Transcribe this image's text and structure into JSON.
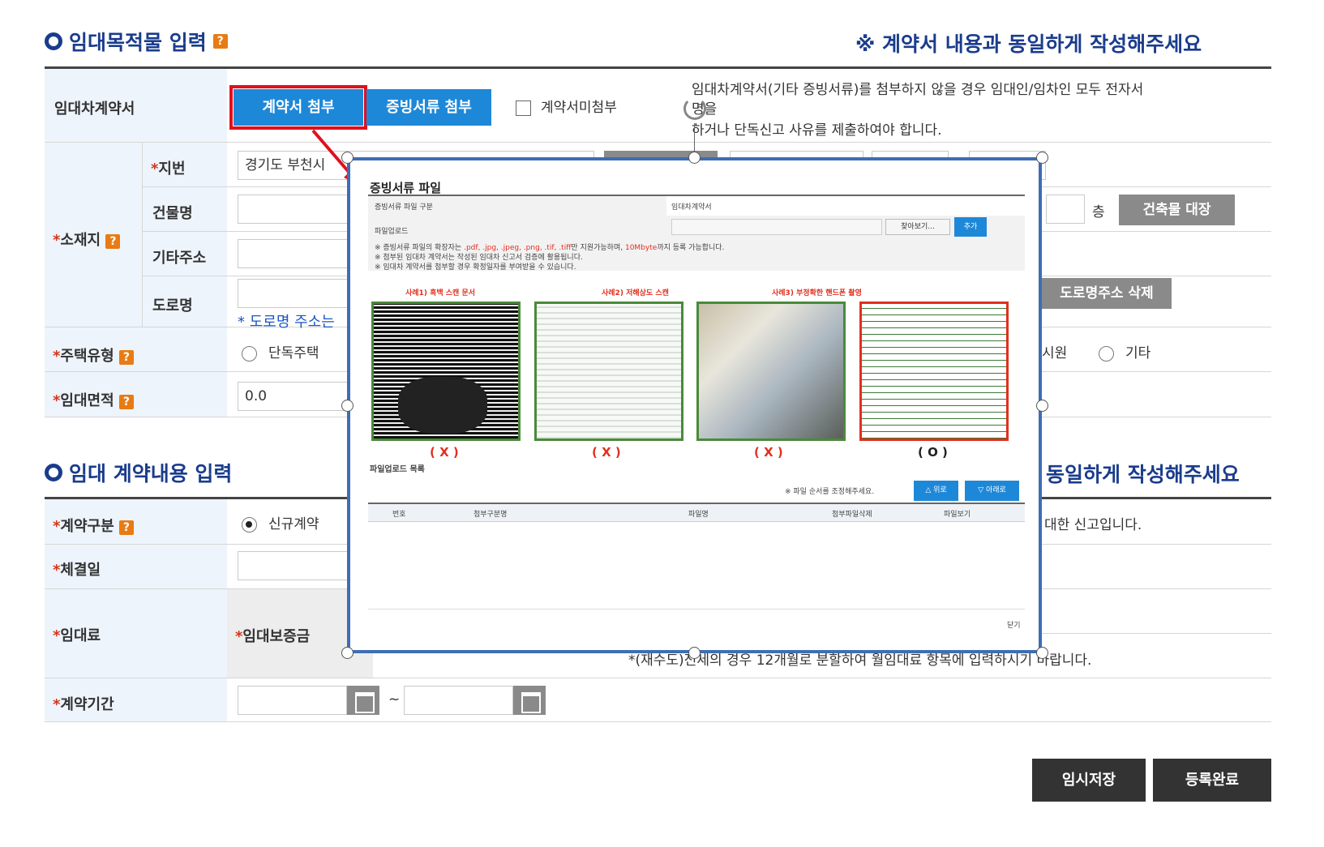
{
  "section1": {
    "title": "임대목적물 입력",
    "notice": "※ 계약서 내용과 동일하게 작성해주세요"
  },
  "contract_row": {
    "label": "임대차계약서",
    "attach_contract_btn": "계약서 첨부",
    "attach_evidence_btn": "증빙서류 첨부",
    "no_attach_label": "계약서미첨부",
    "info_line1": "임대차계약서(기타 증빙서류)를 첨부하지 않을 경우 임대인/임차인 모두 전자서",
    "info_line2": "명을",
    "info_line3": "하거나 단독신고 사유를 제출하여야 합니다."
  },
  "location": {
    "label": "소재지",
    "jibun_label": "지번",
    "jibun_value": "경기도 부천시",
    "building_label": "건물명",
    "floor_unit": "층",
    "building_register_btn": "건축물 대장",
    "other_addr_label": "기타주소",
    "road_label": "도로명",
    "road_hint": "* 도로명 주소는",
    "road_delete_btn": "도로명주소 삭제"
  },
  "housing_type": {
    "label": "주택유형",
    "option_single": "단독주택",
    "option_partial": "시원",
    "option_other": "기타"
  },
  "area": {
    "label": "임대면적",
    "value": "0.0"
  },
  "section2": {
    "title": "임대 계약내용 입력",
    "notice_tail": "동일하게 작성해주세요"
  },
  "contract_type": {
    "label": "계약구분",
    "option_new": "신규계약",
    "note_tail": "대한 신고입니다."
  },
  "signed_date": {
    "label": "체결일"
  },
  "rent": {
    "label": "임대료",
    "deposit_label": "임대보증금",
    "note": "*(재수도)전세의 경우 12개월로 분할하여 월임대료 항목에 입력하시기 바랍니다."
  },
  "period": {
    "label": "계약기간",
    "separator": "~"
  },
  "footer": {
    "temp_save_btn": "임시저장",
    "register_btn": "등록완료"
  },
  "popup": {
    "title": "증빙서류 파일",
    "type_label": "증빙서류 파일 구분",
    "type_value": "임대차계약서",
    "upload_label": "파일업로드",
    "browse_btn": "찾아보기...",
    "add_btn": "추가",
    "note1_prefix": "※ 증빙서류 파일의 확장자는",
    "note1_ext": ".pdf, .jpg, .jpeg, .png, .tif, .tiff",
    "note1_mid": "만 지원가능하며,",
    "note1_size": "10Mbyte",
    "note1_suffix": "까지 등록 가능합니다.",
    "note2": "※ 첨부된 임대차 계약서는 작성된 임대차 신고서 검증에 활용됩니다.",
    "note3": "※ 임대차 계약서를 첨부할 경우 확정일자를 부여받을 수 있습니다.",
    "cases": [
      {
        "label": "사례1) 흑백 스캔 문서",
        "mark": "( X )",
        "border": "#4a8a3a"
      },
      {
        "label": "사례2) 저해상도 스캔",
        "mark": "( X )",
        "border": "#4a8a3a"
      },
      {
        "label": "사례3) 부정확한 핸드폰 촬영",
        "mark": "( X )",
        "border": "#4a8a3a"
      },
      {
        "label": "",
        "mark": "( O )",
        "border": "#e0301e"
      }
    ],
    "list_title": "파일업로드 목록",
    "order_note": "※ 파일 순서를 조정해주세요.",
    "up_btn": "△ 위로",
    "down_btn": "▽ 아래로",
    "columns": [
      "번호",
      "첨부구분명",
      "파일명",
      "첨부파일삭제",
      "파일보기"
    ],
    "close_label": "닫기"
  }
}
